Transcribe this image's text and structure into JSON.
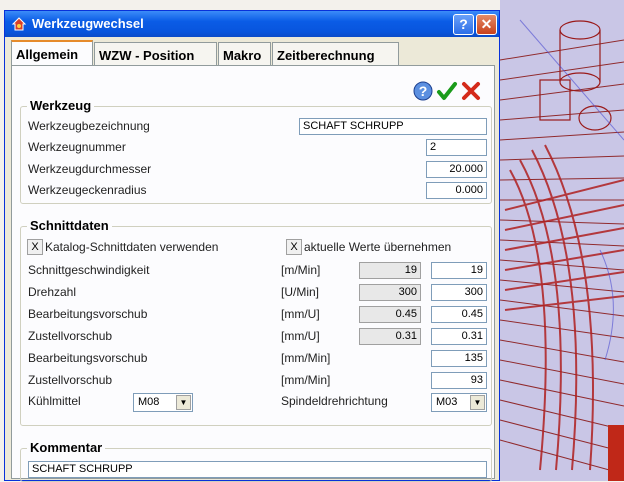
{
  "window": {
    "title": "Werkzeugwechsel",
    "help_btn": "?",
    "close_btn": "✕"
  },
  "tabs": [
    {
      "label": "Allgemein",
      "active": true
    },
    {
      "label": "WZW - Position",
      "active": false
    },
    {
      "label": "Makro",
      "active": false
    },
    {
      "label": "Zeitberechnung",
      "active": false
    }
  ],
  "actions": {
    "help_icon": "question-icon",
    "ok_icon": "checkmark-icon",
    "cancel_icon": "x-icon",
    "ok_color": "#1a9b1a",
    "cancel_color": "#d42a1a"
  },
  "werkzeug": {
    "title": "Werkzeug",
    "bezeichnung_label": "Werkzeugbezeichnung",
    "bezeichnung_value": "SCHAFT SCHRUPP",
    "nummer_label": "Werkzeugnummer",
    "nummer_value": "2",
    "durchmesser_label": "Werkzeugdurchmesser",
    "durchmesser_value": "20.000",
    "eckenradius_label": "Werkzeugeckenradius",
    "eckenradius_value": "0.000"
  },
  "schnittdaten": {
    "title": "Schnittdaten",
    "katalog_check": "X",
    "katalog_label": "Katalog-Schnittdaten verwenden",
    "aktuelle_check": "X",
    "aktuelle_label": "aktuelle Werte übernehmen",
    "rows": [
      {
        "label": "Schnittgeschwindigkeit",
        "unit": "[m/Min]",
        "catalog": "19",
        "value": "19"
      },
      {
        "label": "Drehzahl",
        "unit": "[U/Min]",
        "catalog": "300",
        "value": "300"
      },
      {
        "label": "Bearbeitungsvorschub",
        "unit": "[mm/U]",
        "catalog": "0.45",
        "value": "0.45"
      },
      {
        "label": "Zustellvorschub",
        "unit": "[mm/U]",
        "catalog": "0.31",
        "value": "0.31"
      },
      {
        "label": "Bearbeitungsvorschub",
        "unit": "[mm/Min]",
        "value": "135"
      },
      {
        "label": "Zustellvorschub",
        "unit": "[mm/Min]",
        "value": "93"
      }
    ],
    "kuehlmittel_label": "Kühlmittel",
    "kuehlmittel_value": "M08",
    "spindel_label": "Spindeldrehrichtung",
    "spindel_value": "M03"
  },
  "kommentar": {
    "title": "Kommentar",
    "value": "SCHAFT SCHRUPP"
  }
}
